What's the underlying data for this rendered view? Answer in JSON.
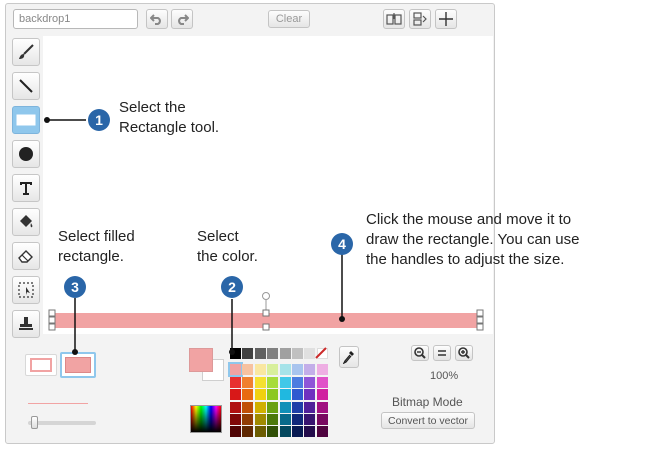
{
  "editor": {
    "costume_name": "backdrop1",
    "clear_label": "Clear",
    "zoom_level": "100%",
    "mode_label": "Bitmap Mode",
    "convert_label": "Convert to vector",
    "brush_size": 0.05
  },
  "annotations": [
    {
      "number": "1",
      "text": [
        "Select the",
        "Rectangle tool."
      ]
    },
    {
      "number": "2",
      "text": [
        "Select",
        "the color."
      ]
    },
    {
      "number": "3",
      "text": [
        "Select filled",
        "rectangle."
      ]
    },
    {
      "number": "4",
      "text": [
        "Click the mouse and move it to",
        "draw the rectangle. You can use",
        "the handles to adjust the size."
      ]
    }
  ],
  "colors": {
    "accent_blue": "#8fc7ec",
    "badge_blue": "#2a66a8",
    "rectangle_fill": "#f1a3a3",
    "selected_color": "#f1a3a3"
  },
  "palette": [
    [
      "#000000",
      "#404040",
      "#606060",
      "#808080",
      "#a0a0a0",
      "#c0c0c0",
      "#e0e0e0",
      "#ffffff"
    ],
    [
      "#f1a3a3",
      "#f7c2a0",
      "#f9e7a0",
      "#d8ef9c",
      "#a6e3e9",
      "#a8c4ee",
      "#c3aee9",
      "#eeaee3"
    ],
    [
      "#e83030",
      "#f08030",
      "#f5e030",
      "#a6dc3a",
      "#41c8e8",
      "#4c7ce0",
      "#8f55d8",
      "#e050c8"
    ],
    [
      "#d81818",
      "#e86a10",
      "#f0d010",
      "#8cc820",
      "#20b8e0",
      "#2f5ad0",
      "#7030c0",
      "#d020a0"
    ],
    [
      "#b01010",
      "#c05008",
      "#d0b000",
      "#6aa010",
      "#1090b8",
      "#1e3fa8",
      "#50209a",
      "#a01080"
    ],
    [
      "#800808",
      "#903c04",
      "#a08a00",
      "#4c780a",
      "#086a8a",
      "#10287a",
      "#381470",
      "#780860"
    ],
    [
      "#500404",
      "#602802",
      "#6c5c00",
      "#305006",
      "#04485e",
      "#081a52",
      "#240c4c",
      "#500440"
    ]
  ]
}
